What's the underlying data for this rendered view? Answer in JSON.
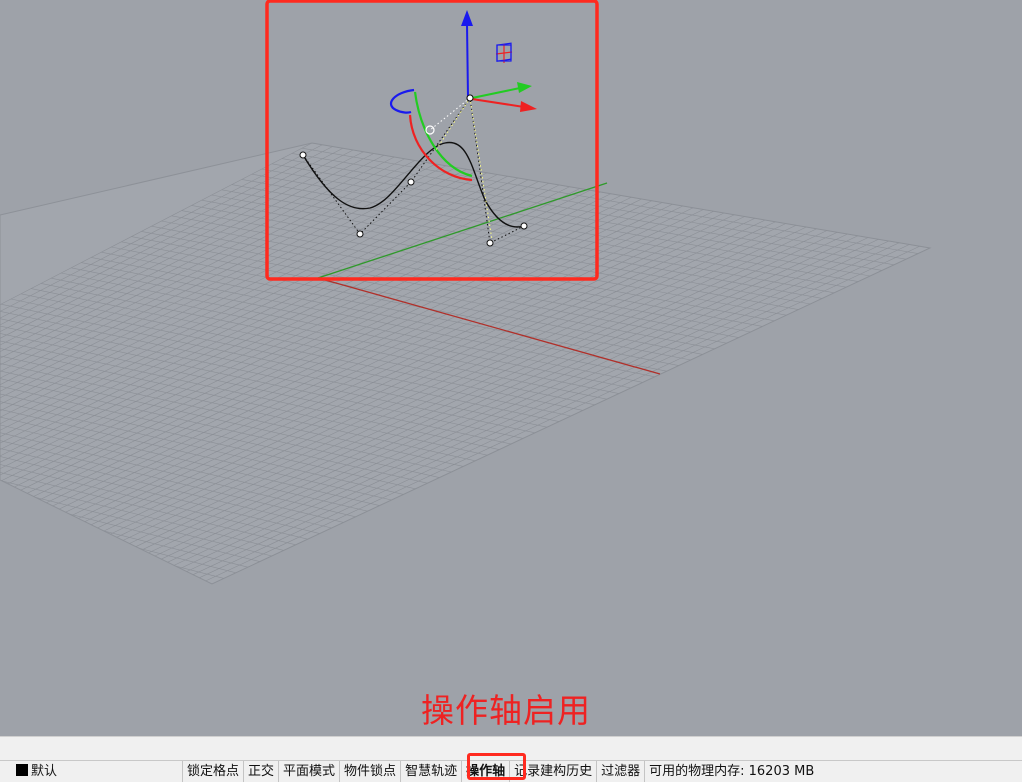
{
  "caption": "操作轴启用",
  "statusbar": {
    "layer": "默认",
    "items": [
      {
        "label": "锁定格点",
        "active": false
      },
      {
        "label": "正交",
        "active": false
      },
      {
        "label": "平面模式",
        "active": false
      },
      {
        "label": "物件锁点",
        "active": false
      },
      {
        "label": "智慧轨迹",
        "active": false
      },
      {
        "label": "操作轴",
        "active": true
      },
      {
        "label": "记录建构历史",
        "active": false
      },
      {
        "label": "过滤器",
        "active": false
      }
    ],
    "memory": "可用的物理内存: 16203 MB"
  },
  "colors": {
    "viewport_bg": "#9ea2a9",
    "grid_line": "#8a8e95",
    "x_axis": "#b0302a",
    "y_axis": "#2f9a2a",
    "highlight": "#ff2a1f",
    "gumball_x": "#ee2222",
    "gumball_y": "#22cc22",
    "gumball_z": "#1a1aee"
  },
  "icons": [
    "layer-color-swatch",
    "gumball-gizmo",
    "plane-handle-icon"
  ]
}
